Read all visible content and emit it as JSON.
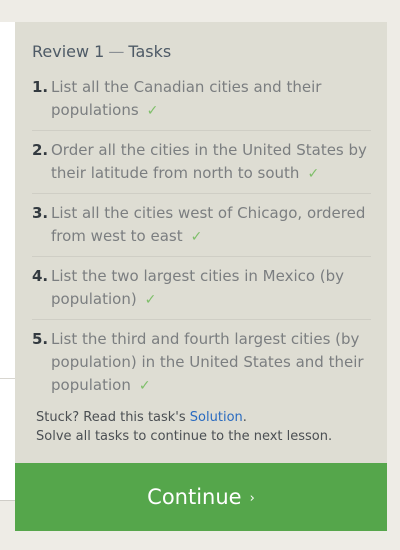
{
  "panel": {
    "title_prefix": "Review 1",
    "title_sep": "—",
    "title_suffix": "Tasks"
  },
  "tasks": [
    {
      "num": "1.",
      "text": "List all the Canadian cities and their populations",
      "check": "✓"
    },
    {
      "num": "2.",
      "text": "Order all the cities in the United States by their latitude from north to south",
      "check": "✓"
    },
    {
      "num": "3.",
      "text": "List all the cities west of Chicago, ordered from west to east",
      "check": "✓"
    },
    {
      "num": "4.",
      "text": "List the two largest cities in Mexico (by population)",
      "check": "✓"
    },
    {
      "num": "5.",
      "text": "List the third and fourth largest cities (by population) in the United States and their population",
      "check": "✓"
    }
  ],
  "help": {
    "stuck_prefix": "Stuck? Read this task's ",
    "solution_link": "Solution",
    "stuck_suffix": ".",
    "hint": "Solve all tasks to continue to the next lesson."
  },
  "continue_button": {
    "label": "Continue",
    "arrow": "›"
  },
  "colors": {
    "panel_bg": "#deddd3",
    "continue_bg": "#55a64b",
    "check": "#7fbf6a",
    "link": "#2a6bc0"
  }
}
